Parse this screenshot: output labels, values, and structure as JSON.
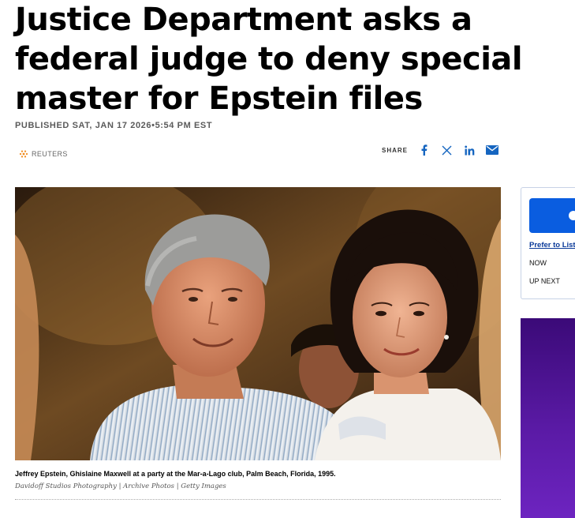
{
  "article": {
    "headline": "Justice Department asks a federal judge to deny special master for Epstein files",
    "published": "PUBLISHED SAT, JAN 17 2026•5:54 PM EST",
    "source_label": "REUTERS",
    "share_label": "SHARE",
    "share_icons": [
      "facebook-icon",
      "x-icon",
      "linkedin-icon",
      "email-icon"
    ],
    "image": {
      "caption": "Jeffrey Epstein, Ghislaine Maxwell at a party at the Mar-a-Lago club, Palm Beach, Florida, 1995.",
      "credit": "Davidoff Studios Photography | Archive Photos | Getty Images"
    },
    "accent_color": "#0a5de0"
  },
  "rail": {
    "link": "Prefer to List",
    "now": "NOW",
    "up_next": "UP NEXT",
    "ad_color": "#5a1aa5"
  }
}
